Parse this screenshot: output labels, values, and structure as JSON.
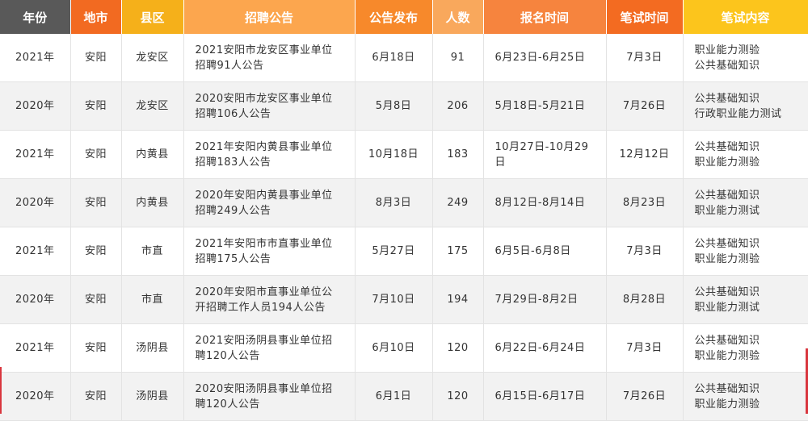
{
  "header": {
    "year": "年份",
    "city": "地市",
    "county": "县区",
    "notice": "招聘公告",
    "publish": "公告发布",
    "count": "人数",
    "signup": "报名时间",
    "exam_time": "笔试时间",
    "exam_content": "笔试内容"
  },
  "colors": {
    "year": "#595959",
    "city": "#f26a21",
    "county": "#f5b01a",
    "notice": "#fca64e",
    "publish": "#f7892b",
    "count": "#f9a85c",
    "signup": "#f6843e",
    "exam_time": "#f36b21",
    "exam_content": "#fcc51c"
  },
  "rows": [
    {
      "year": "2021年",
      "city": "安阳",
      "county": "龙安区",
      "notice1": "2021安阳市龙安区事业单位",
      "notice2": "招聘91人公告",
      "publish": "6月18日",
      "count": "91",
      "signup1": "6月23日-6月25日",
      "signup2": "",
      "exam_time": "7月3日",
      "content1": "职业能力测验",
      "content2": "公共基础知识"
    },
    {
      "year": "2020年",
      "city": "安阳",
      "county": "龙安区",
      "notice1": "2020安阳市龙安区事业单位",
      "notice2": "招聘106人公告",
      "publish": "5月8日",
      "count": "206",
      "signup1": "5月18日-5月21日",
      "signup2": "",
      "exam_time": "7月26日",
      "content1": "公共基础知识",
      "content2": "行政职业能力测试"
    },
    {
      "year": "2021年",
      "city": "安阳",
      "county": "内黄县",
      "notice1": "2021年安阳内黄县事业单位",
      "notice2": "招聘183人公告",
      "publish": "10月18日",
      "count": "183",
      "signup1": "10月27日-10月29",
      "signup2": "日",
      "exam_time": "12月12日",
      "content1": "公共基础知识",
      "content2": "职业能力测验"
    },
    {
      "year": "2020年",
      "city": "安阳",
      "county": "内黄县",
      "notice1": "2020年安阳内黄县事业单位",
      "notice2": "招聘249人公告",
      "publish": "8月3日",
      "count": "249",
      "signup1": "8月12日-8月14日",
      "signup2": "",
      "exam_time": "8月23日",
      "content1": "公共基础知识",
      "content2": "职业能力测试"
    },
    {
      "year": "2021年",
      "city": "安阳",
      "county": "市直",
      "notice1": "2021年安阳市市直事业单位",
      "notice2": "招聘175人公告",
      "publish": "5月27日",
      "count": "175",
      "signup1": "6月5日-6月8日",
      "signup2": "",
      "exam_time": "7月3日",
      "content1": "公共基础知识",
      "content2": "职业能力测验"
    },
    {
      "year": "2020年",
      "city": "安阳",
      "county": "市直",
      "notice1": "2020年安阳市直事业单位公",
      "notice2": "开招聘工作人员194人公告",
      "publish": "7月10日",
      "count": "194",
      "signup1": "7月29日-8月2日",
      "signup2": "",
      "exam_time": "8月28日",
      "content1": "公共基础知识",
      "content2": "职业能力测试"
    },
    {
      "year": "2021年",
      "city": "安阳",
      "county": "汤阴县",
      "notice1": "2021安阳汤阴县事业单位招",
      "notice2": "聘120人公告",
      "publish": "6月10日",
      "count": "120",
      "signup1": "6月22日-6月24日",
      "signup2": "",
      "exam_time": "7月3日",
      "content1": "公共基础知识",
      "content2": "职业能力测验"
    },
    {
      "year": "2020年",
      "city": "安阳",
      "county": "汤阴县",
      "notice1": "2020安阳汤阴县事业单位招",
      "notice2": "聘120人公告",
      "publish": "6月1日",
      "count": "120",
      "signup1": "6月15日-6月17日",
      "signup2": "",
      "exam_time": "7月26日",
      "content1": "公共基础知识",
      "content2": "职业能力测验"
    }
  ]
}
